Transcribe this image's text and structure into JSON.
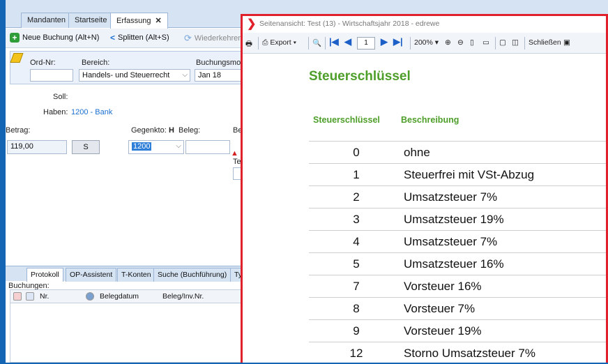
{
  "tabs": [
    {
      "label": "Mandanten"
    },
    {
      "label": "Startseite"
    },
    {
      "label": "Erfassung",
      "close": "✕"
    }
  ],
  "toolbar": {
    "new_booking": "Neue Buchung (Alt+N)",
    "split": "Splitten (Alt+S)",
    "recurring": "Wiederkehrend"
  },
  "form": {
    "ord_label": "Ord-Nr:",
    "ord_value": "",
    "bereich_label": "Bereich:",
    "bereich_value": "Handels- und Steuerrecht",
    "monat_label": "Buchungsmonat",
    "monat_value": "Jan 18",
    "soll_label": "Soll:",
    "haben_label": "Haben:",
    "haben_value": "1200 - Bank",
    "betrag_label": "Betrag:",
    "betrag_value": "119,00",
    "s_button": "S",
    "gegenkto_label": "Gegenkto:",
    "gegenkto_flag": "H",
    "gegenkto_value": "1200",
    "beleg_label": "Beleg:",
    "be_label": "Be",
    "te_label": "Te"
  },
  "bottom": {
    "tabs": [
      "Protokoll",
      "OP-Assistent",
      "T-Konten",
      "Suche (Buchführung)",
      "Typ"
    ],
    "buchungen_label": "Buchungen:",
    "col_nr": "Nr.",
    "col_belegdatum": "Belegdatum",
    "col_beleg": "Beleg/Inv.Nr."
  },
  "preview": {
    "title": "Seitenansicht: Test (13) - Wirtschaftsjahr 2018 - edrewe",
    "export": "Export",
    "page": "1",
    "zoom": "200%",
    "close": "Schließen",
    "report_title": "Steuerschlüssel",
    "col_key": "Steuerschlüssel",
    "col_desc": "Beschreibung",
    "rows": [
      {
        "key": "0",
        "desc": "ohne"
      },
      {
        "key": "1",
        "desc": "Steuerfrei mit VSt-Abzug"
      },
      {
        "key": "2",
        "desc": "Umsatzsteuer 7%"
      },
      {
        "key": "3",
        "desc": "Umsatzsteuer 19%"
      },
      {
        "key": "4",
        "desc": "Umsatzsteuer 7%"
      },
      {
        "key": "5",
        "desc": "Umsatzsteuer 16%"
      },
      {
        "key": "7",
        "desc": "Vorsteuer 16%"
      },
      {
        "key": "8",
        "desc": "Vorsteuer 7%"
      },
      {
        "key": "9",
        "desc": "Vorsteuer 19%"
      },
      {
        "key": "12",
        "desc": "Storno Umsatzsteuer 7%"
      }
    ]
  },
  "colors": {
    "accent_green": "#4e9e2a",
    "frame_red": "#e0202a",
    "window_blue": "#1565b5"
  }
}
